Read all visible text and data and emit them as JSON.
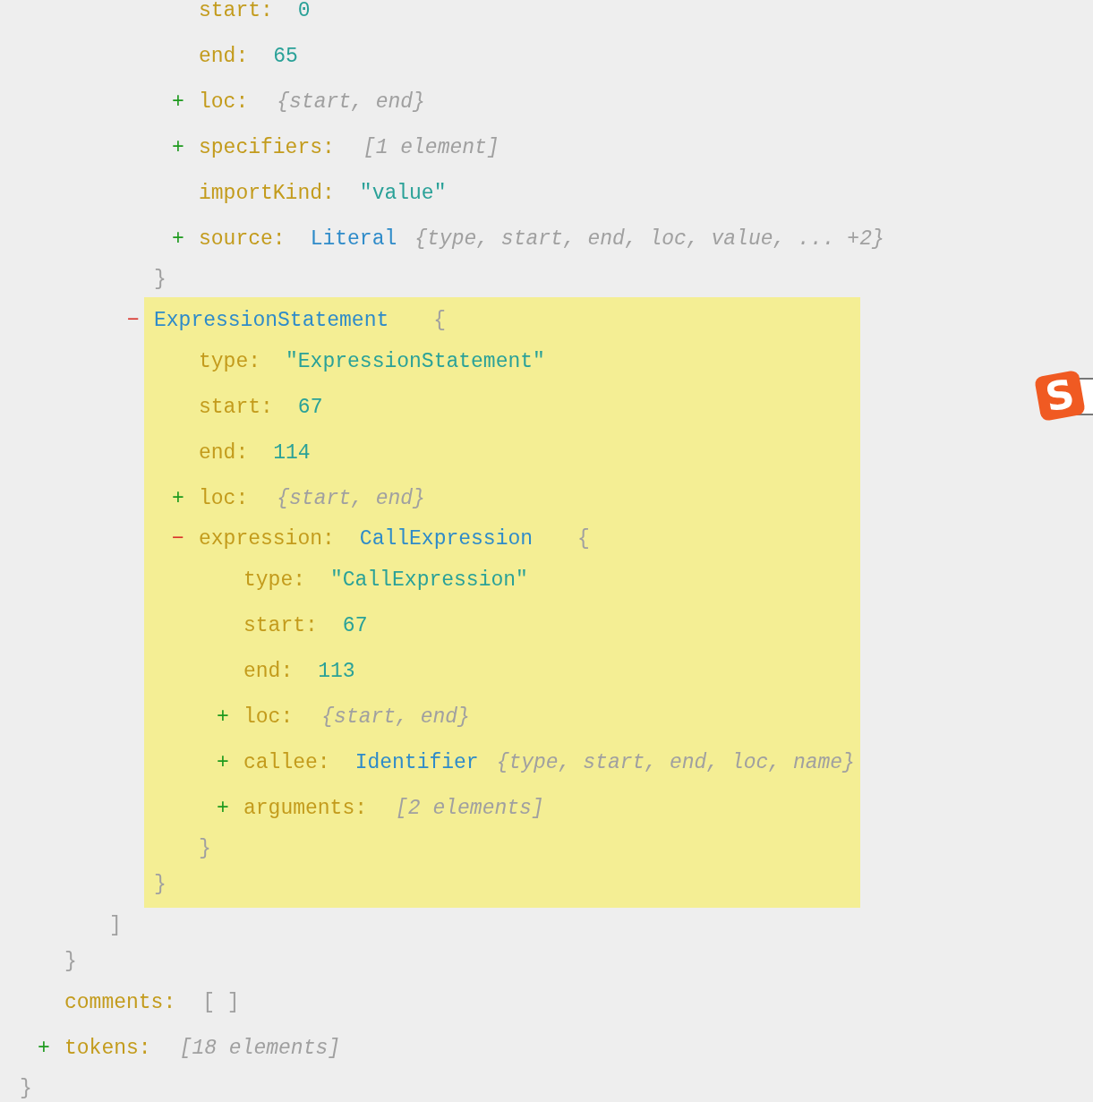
{
  "tree": {
    "kind": "object",
    "close": "}",
    "children": [
      {
        "kind": "object",
        "close": "}",
        "children": [
          {
            "kind": "object",
            "close": "]",
            "children": [
              {
                "kind": "object",
                "close": "}",
                "children": [
                  {
                    "kind": "leaf",
                    "key": "start:",
                    "value": "0"
                  },
                  {
                    "kind": "leaf",
                    "key": "end:",
                    "value": "65"
                  },
                  {
                    "kind": "collapsed",
                    "toggle": "+",
                    "key": "loc:",
                    "summary": "{start, end}"
                  },
                  {
                    "kind": "collapsed",
                    "toggle": "+",
                    "key": "specifiers:",
                    "summary": "[1 element]"
                  },
                  {
                    "kind": "leaf",
                    "key": "importKind:",
                    "value": "\"value\""
                  },
                  {
                    "kind": "collapsed",
                    "toggle": "+",
                    "key": "source:",
                    "type": "Literal",
                    "summary": "{type, start, end, loc, value, ... +2}"
                  }
                ]
              },
              {
                "kind": "object",
                "selected": true,
                "toggle": "−",
                "type": "ExpressionStatement",
                "open": "{",
                "close": "}",
                "children": [
                  {
                    "kind": "leaf",
                    "key": "type:",
                    "value": "\"ExpressionStatement\""
                  },
                  {
                    "kind": "leaf",
                    "key": "start:",
                    "value": "67"
                  },
                  {
                    "kind": "leaf",
                    "key": "end:",
                    "value": "114"
                  },
                  {
                    "kind": "collapsed",
                    "toggle": "+",
                    "key": "loc:",
                    "summary": "{start, end}"
                  },
                  {
                    "kind": "object",
                    "toggle": "−",
                    "key": "expression:",
                    "type": "CallExpression",
                    "open": "{",
                    "close": "}",
                    "children": [
                      {
                        "kind": "leaf",
                        "key": "type:",
                        "value": "\"CallExpression\""
                      },
                      {
                        "kind": "leaf",
                        "key": "start:",
                        "value": "67"
                      },
                      {
                        "kind": "leaf",
                        "key": "end:",
                        "value": "113"
                      },
                      {
                        "kind": "collapsed",
                        "toggle": "+",
                        "key": "loc:",
                        "summary": "{start, end}"
                      },
                      {
                        "kind": "collapsed",
                        "toggle": "+",
                        "key": "callee:",
                        "type": "Identifier",
                        "summary": "{type, start, end, loc, name}"
                      },
                      {
                        "kind": "collapsed",
                        "toggle": "+",
                        "key": "arguments:",
                        "summary": "[2 elements]"
                      }
                    ]
                  }
                ]
              }
            ]
          }
        ]
      },
      {
        "kind": "empty",
        "key": "comments:",
        "value": "[ ]"
      },
      {
        "kind": "collapsed",
        "toggle": "+",
        "key": "tokens:",
        "summary": "[18 elements]"
      }
    ]
  },
  "ime_badge": {
    "label": "S"
  }
}
